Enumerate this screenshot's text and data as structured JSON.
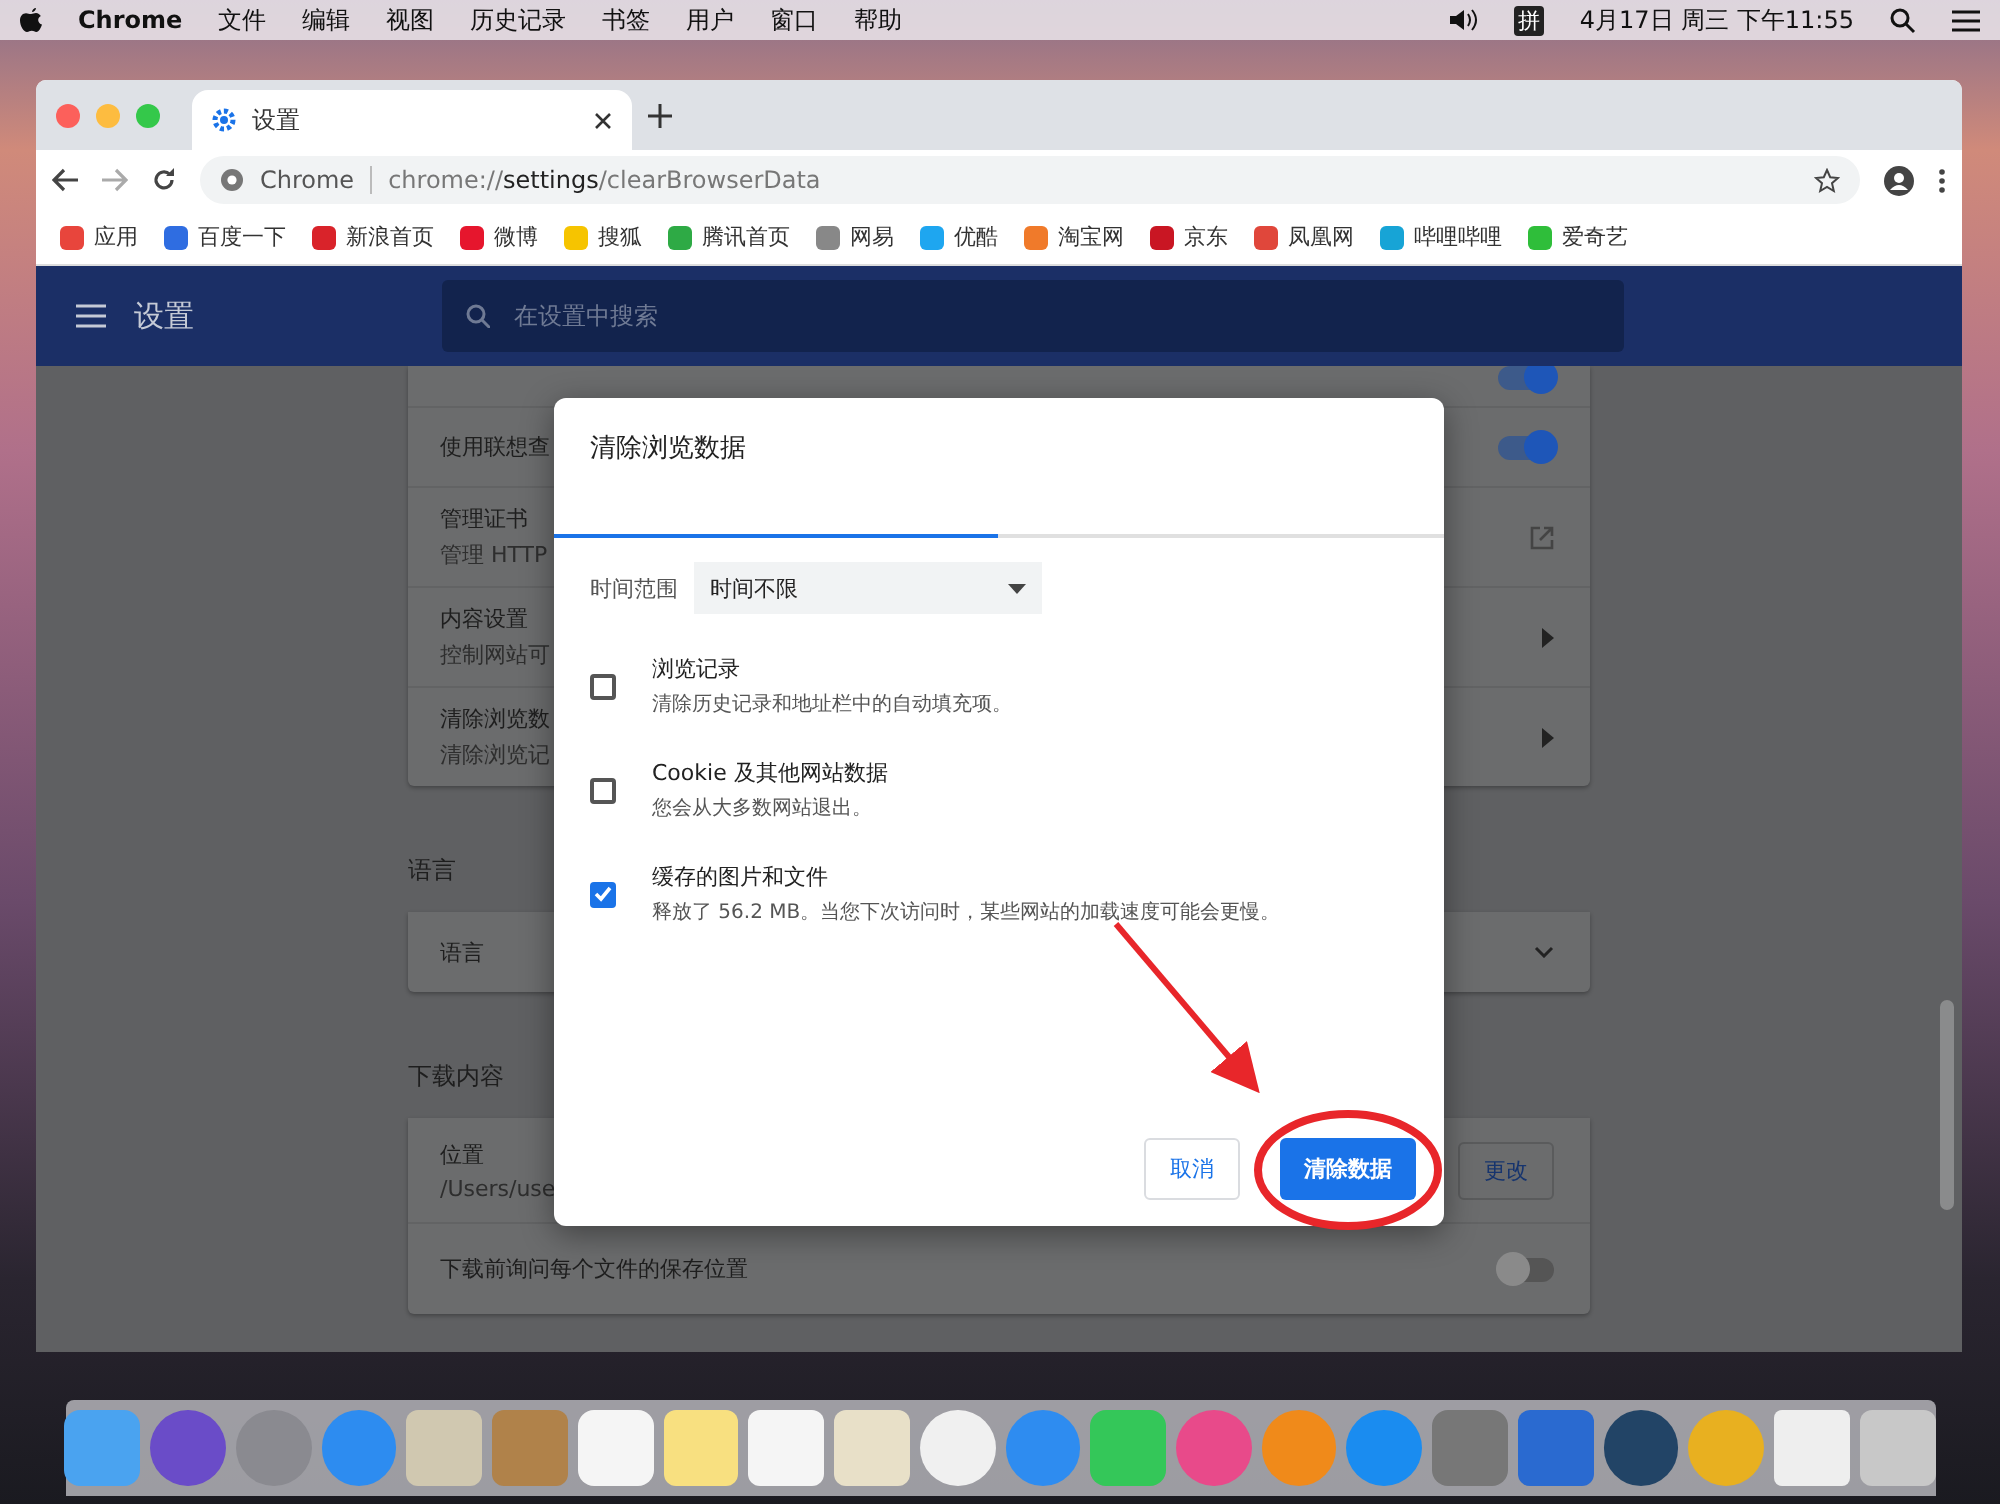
{
  "menu_bar": {
    "app": "Chrome",
    "items": [
      "文件",
      "编辑",
      "视图",
      "历史记录",
      "书签",
      "用户",
      "窗口",
      "帮助"
    ],
    "input_method": "拼",
    "clock": "4月17日 周三 下午11:55"
  },
  "browser": {
    "tabs": [
      {
        "label": "设置",
        "selected": true
      }
    ],
    "omnibox": {
      "site": "Chrome",
      "url_prefix": "chrome://",
      "url_host": "settings",
      "url_path": "/clearBrowserData"
    },
    "bookmarks": [
      {
        "label": "应用",
        "color": "#e8453c"
      },
      {
        "label": "百度一下",
        "color": "#2f6de1"
      },
      {
        "label": "新浪首页",
        "color": "#d9232a"
      },
      {
        "label": "微博",
        "color": "#e6162d"
      },
      {
        "label": "搜狐",
        "color": "#f6c400"
      },
      {
        "label": "腾讯首页",
        "color": "#2eaa45"
      },
      {
        "label": "网易",
        "color": "#888888"
      },
      {
        "label": "优酷",
        "color": "#1ea6f0"
      },
      {
        "label": "淘宝网",
        "color": "#f07a2a"
      },
      {
        "label": "京东",
        "color": "#c91623"
      },
      {
        "label": "凤凰网",
        "color": "#e0473b"
      },
      {
        "label": "哔哩哔哩",
        "color": "#17a4d6"
      },
      {
        "label": "爱奇艺",
        "color": "#2fbe3a"
      }
    ]
  },
  "settings": {
    "title": "设置",
    "search": {
      "placeholder": "在设置中搜索"
    },
    "privacy_rows": [
      {
        "kind": "toggle",
        "on": true
      },
      {
        "kind": "toggle",
        "title": "使用联想查",
        "on": true
      },
      {
        "kind": "external",
        "title": "管理证书",
        "subtitle": "管理 HTTP"
      },
      {
        "kind": "arrow",
        "title": "内容设置",
        "subtitle": "控制网站可"
      },
      {
        "kind": "arrow",
        "title": "清除浏览数",
        "subtitle": "清除浏览记"
      }
    ],
    "language_section": {
      "heading": "语言",
      "row": "语言",
      "expanded": false
    },
    "downloads_section": {
      "heading": "下载内容",
      "location_label": "位置",
      "location_value": "/Users/use",
      "change_button": "更改",
      "ask_row": "下载前询问每个文件的保存位置",
      "ask_on": false
    }
  },
  "dialog": {
    "title": "清除浏览数据",
    "time_range_label": "时间范围",
    "time_range_value": "时间不限",
    "items": [
      {
        "title": "浏览记录",
        "description": "清除历史记录和地址栏中的自动填充项。",
        "checked": false
      },
      {
        "title": "Cookie 及其他网站数据",
        "description": "您会从大多数网站退出。",
        "checked": false
      },
      {
        "title": "缓存的图片和文件",
        "description": "释放了 56.2 MB。当您下次访问时，某些网站的加载速度可能会更慢。",
        "checked": true
      }
    ],
    "cancel_button": "取消",
    "confirm_button": "清除数据"
  }
}
